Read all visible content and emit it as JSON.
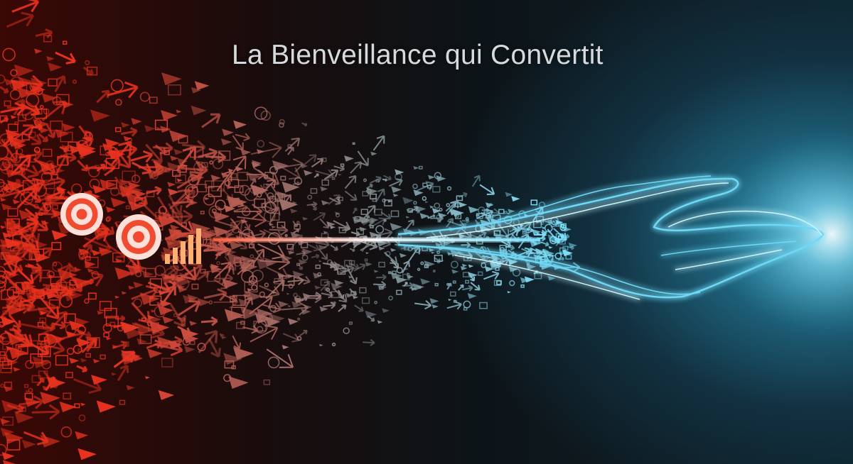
{
  "title": "La Bienveillance qui Convertit",
  "colors": {
    "left": "#e8321e",
    "middle": "#8a8a8a",
    "right": "#7fe4ff"
  }
}
